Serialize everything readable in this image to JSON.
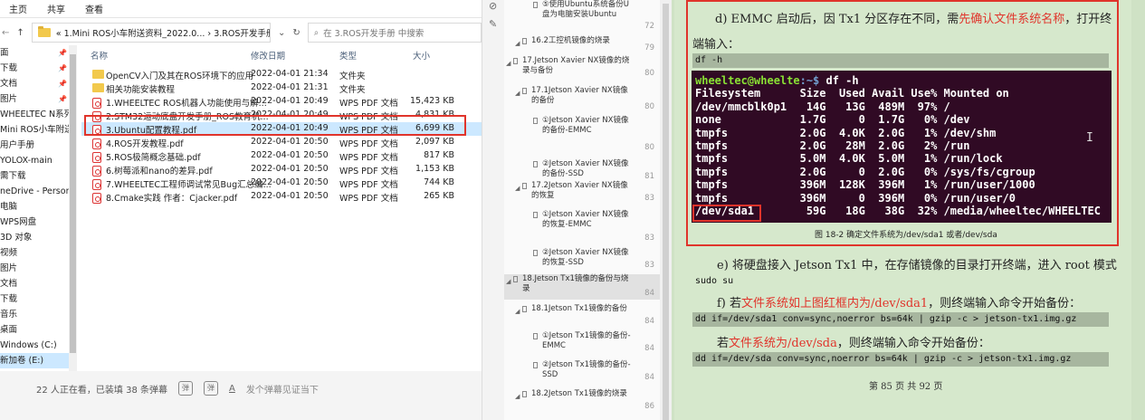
{
  "ribbon": {
    "tabs": [
      "主页",
      "共享",
      "查看"
    ]
  },
  "address": {
    "path": "« 1.Mini ROS小车附送资料_2022.0... › 3.ROS开发手册",
    "search_placeholder": "在 3.ROS开发手册 中搜索",
    "up": "↑",
    "refresh": "↻",
    "dropdown": "⌄",
    "back_arrow": "←"
  },
  "nav_pane": {
    "items": [
      "面",
      "下载",
      "文档",
      "图片",
      "WHEELTEC N系列",
      "Mini ROS小车附送",
      "用户手册",
      "YOLOX-main",
      "需下载",
      "neDrive - Personal",
      "电脑",
      "WPS网盘",
      "3D 对象",
      "视频",
      "图片",
      "文档",
      "下载",
      "音乐",
      "桌面",
      "Windows (C:)",
      "新加卷 (E:)"
    ],
    "selected_index": 20
  },
  "columns": {
    "name": "名称",
    "date": "修改日期",
    "type": "类型",
    "size": "大小"
  },
  "files": [
    {
      "name": "OpenCV入门及其在ROS环境下的应用",
      "date": "2022-04-01 21:34",
      "type": "文件夹",
      "size": "",
      "icon": "folder-icon"
    },
    {
      "name": "相关功能安装教程",
      "date": "2022-04-01 21:31",
      "type": "文件夹",
      "size": "",
      "icon": "folder-icon"
    },
    {
      "name": "1.WHEELTEC ROS机器人功能使用与解...",
      "date": "2022-04-01 20:49",
      "type": "WPS PDF 文档",
      "size": "15,423 KB",
      "icon": "pdf-icon"
    },
    {
      "name": "2.STM32运动底盘开发手册_ROS教育机...",
      "date": "2022-04-01 20:49",
      "type": "WPS PDF 文档",
      "size": "4,831 KB",
      "icon": "pdf-icon"
    },
    {
      "name": "3.Ubuntu配置教程.pdf",
      "date": "2022-04-01 20:49",
      "type": "WPS PDF 文档",
      "size": "6,699 KB",
      "icon": "pdf-icon"
    },
    {
      "name": "4.ROS开发教程.pdf",
      "date": "2022-04-01 20:50",
      "type": "WPS PDF 文档",
      "size": "2,097 KB",
      "icon": "pdf-icon"
    },
    {
      "name": "5.ROS极简概念基础.pdf",
      "date": "2022-04-01 20:50",
      "type": "WPS PDF 文档",
      "size": "817 KB",
      "icon": "pdf-icon"
    },
    {
      "name": "6.树莓派和nano的差异.pdf",
      "date": "2022-04-01 20:50",
      "type": "WPS PDF 文档",
      "size": "1,153 KB",
      "icon": "pdf-icon"
    },
    {
      "name": "7.WHEELTEC工程师调试常见Bug汇总编...",
      "date": "2022-04-01 20:50",
      "type": "WPS PDF 文档",
      "size": "744 KB",
      "icon": "pdf-icon"
    },
    {
      "name": "8.Cmake实践 作者：Cjacker.pdf",
      "date": "2022-04-01 20:50",
      "type": "WPS PDF 文档",
      "size": "265 KB",
      "icon": "pdf-icon"
    }
  ],
  "video_bar": {
    "viewers": "22 人正在看，已装填 38 条弹幕",
    "danmaku_placeholder": "发个弹幕见证当下",
    "icon1": "弹",
    "icon2": "弹",
    "icon3": "A"
  },
  "outline": [
    {
      "text": "⑤使用Ubuntu系统备份U盘为电脑安装Ubuntu",
      "page": "72",
      "level": 3
    },
    {
      "text": "16.2工控机镜像的烧录",
      "page": "79",
      "level": 2
    },
    {
      "text": "17.Jetson Xavier NX镜像的烧录与备份",
      "page": "80",
      "level": 1
    },
    {
      "text": "17.1Jetson Xavier NX镜像的备份",
      "page": "80",
      "level": 2
    },
    {
      "text": "①Jetson Xavier NX镜像的备份-EMMC",
      "page": "80",
      "level": 3
    },
    {
      "text": "②Jetson Xavier NX镜像的备份-SSD",
      "page": "81",
      "level": 3
    },
    {
      "text": "17.2Jetson Xavier NX镜像的恢复",
      "page": "83",
      "level": 2
    },
    {
      "text": "①Jetson Xavier NX镜像的恢复-EMMC",
      "page": "83",
      "level": 3
    },
    {
      "text": "②Jetson Xavier NX镜像的恢复-SSD",
      "page": "83",
      "level": 3
    },
    {
      "text": "18.Jetson Tx1镜像的备份与烧录",
      "page": "84",
      "level": 1
    },
    {
      "text": "18.1Jetson Tx1镜像的备份",
      "page": "84",
      "level": 2
    },
    {
      "text": "①Jetson Tx1镜像的备份-EMMC",
      "page": "84",
      "level": 3
    },
    {
      "text": "②Jetson Tx1镜像的备份-SSD",
      "page": "84",
      "level": 3
    },
    {
      "text": "18.2Jetson Tx1镜像的烧录",
      "page": "86",
      "level": 2
    }
  ],
  "doc": {
    "para_d_1": "d) EMMC 启动后，因 Tx1 分区存在不同，需",
    "para_d_red": "先确认文件系统名称",
    "para_d_2": "，打开终",
    "para_d_3": "端输入：",
    "code_df": "df -h",
    "terminal": {
      "prompt": "wheeltec@wheelte",
      "prompt_path": ":~$ ",
      "cmd": "df -h",
      "lines": [
        "Filesystem      Size  Used Avail Use% Mounted on",
        "/dev/mmcblk0p1   14G   13G  489M  97% /",
        "none            1.7G     0  1.7G   0% /dev",
        "tmpfs           2.0G  4.0K  2.0G   1% /dev/shm",
        "tmpfs           2.0G   28M  2.0G   2% /run",
        "tmpfs           5.0M  4.0K  5.0M   1% /run/lock",
        "tmpfs           2.0G     0  2.0G   0% /sys/fs/cgroup",
        "tmpfs           396M  128K  396M   1% /run/user/1000",
        "tmpfs           396M     0  396M   0% /run/user/0",
        "/dev/sda1        59G   18G   38G  32% /media/wheeltec/WHEELTEC"
      ]
    },
    "caption": "图 18-2 确定文件系统为/dev/sda1 或者/dev/sda",
    "para_e": "e) 将硬盘接入 Jetson Tx1 中，在存储镜像的目录打开终端，进入 root 模式",
    "code_sudo": "sudo su",
    "para_f_1": "f) 若",
    "para_f_red": "文件系统如上图红框内为/dev/sda1",
    "para_f_2": "，则终端输入命令开始备份：",
    "code_sda1": "dd if=/dev/sda1 conv=sync,noerror bs=64k | gzip -c > jetson-tx1.img.gz",
    "para_g_1": "若",
    "para_g_red": "文件系统为/dev/sda",
    "para_g_2": "，则终端输入命令开始备份：",
    "code_sda": "dd if=/dev/sda conv=sync,noerror bs=64k | gzip -c > jetson-tx1.img.gz",
    "footer": "第 85 页 共 92 页",
    "cursor": "I"
  }
}
